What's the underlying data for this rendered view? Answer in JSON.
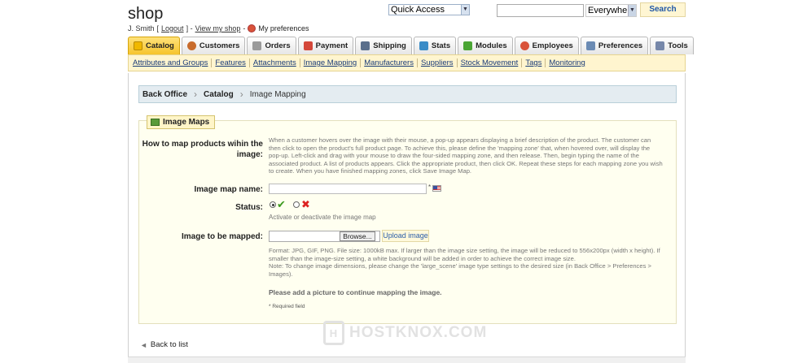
{
  "header": {
    "shop_name": "shop",
    "user_name": "J. Smith",
    "logout_label": "Logout",
    "view_shop_label": "View my shop",
    "my_prefs_label": "My preferences",
    "quick_access_label": "Quick Access",
    "search_scope": "Everywhere",
    "search_button": "Search"
  },
  "tabs": [
    {
      "label": "Catalog",
      "icon": "catalog-icon",
      "active": true,
      "color": "#f0b800"
    },
    {
      "label": "Customers",
      "icon": "customers-icon",
      "active": false,
      "color": "#c86b2c"
    },
    {
      "label": "Orders",
      "icon": "orders-icon",
      "active": false,
      "color": "#8a8a8a"
    },
    {
      "label": "Payment",
      "icon": "payment-icon",
      "active": false,
      "color": "#d4473a"
    },
    {
      "label": "Shipping",
      "icon": "shipping-icon",
      "active": false,
      "color": "#5a6f8c"
    },
    {
      "label": "Stats",
      "icon": "stats-icon",
      "active": false,
      "color": "#3a8cc7"
    },
    {
      "label": "Modules",
      "icon": "modules-icon",
      "active": false,
      "color": "#4aa534"
    },
    {
      "label": "Employees",
      "icon": "employees-icon",
      "active": false,
      "color": "#d9533a"
    },
    {
      "label": "Preferences",
      "icon": "preferences-icon",
      "active": false,
      "color": "#6b8bb4"
    },
    {
      "label": "Tools",
      "icon": "tools-icon",
      "active": false,
      "color": "#7788aa"
    }
  ],
  "subnav": [
    "Attributes and Groups",
    "Features",
    "Attachments",
    "Image Mapping",
    "Manufacturers",
    "Suppliers",
    "Stock Movement",
    "Tags",
    "Monitoring"
  ],
  "breadcrumb": {
    "items": [
      "Back Office",
      "Catalog"
    ],
    "current": "Image Mapping"
  },
  "form": {
    "legend": "Image Maps",
    "how_label": "How to map products wihin the image:",
    "how_text": "When a customer hovers over the image with their mouse, a pop-up appears displaying a brief description of the product. The customer can then click to open the product's full product page. To achieve this, please define the 'mapping zone' that, when hovered over, will display the pop-up. Left-click and drag with your mouse to draw the four-sided mapping zone, and then release. Then, begin typing the name of the associated product. A list of products appears. Click the appropriate product, then click OK. Repeat these steps for each mapping zone you wish to create. When you have finished mapping zones, click Save Image Map.",
    "name_label": "Image map name:",
    "name_value": "",
    "required_star": "*",
    "status_label": "Status:",
    "status_help": "Activate or deactivate the image map",
    "image_label": "Image to be mapped:",
    "browse_label": "Browse...",
    "upload_label": "Upload image",
    "format_text": "Format: JPG, GIF, PNG. File size: 1000kB max. If larger than the image size setting, the image will be reduced to 556x200px (width x height). If smaller than the image-size setting, a white background will be added in order to achieve the correct image size.",
    "dimensions_note": "Note: To change image dimensions, please change the 'large_scene' image type settings to the desired size (in Back Office > Preferences > Images).",
    "notice": "Please add a picture to continue mapping the image.",
    "required_note": "* Required field"
  },
  "back_label": "Back to list",
  "watermark": "HOSTKNOX.COM"
}
